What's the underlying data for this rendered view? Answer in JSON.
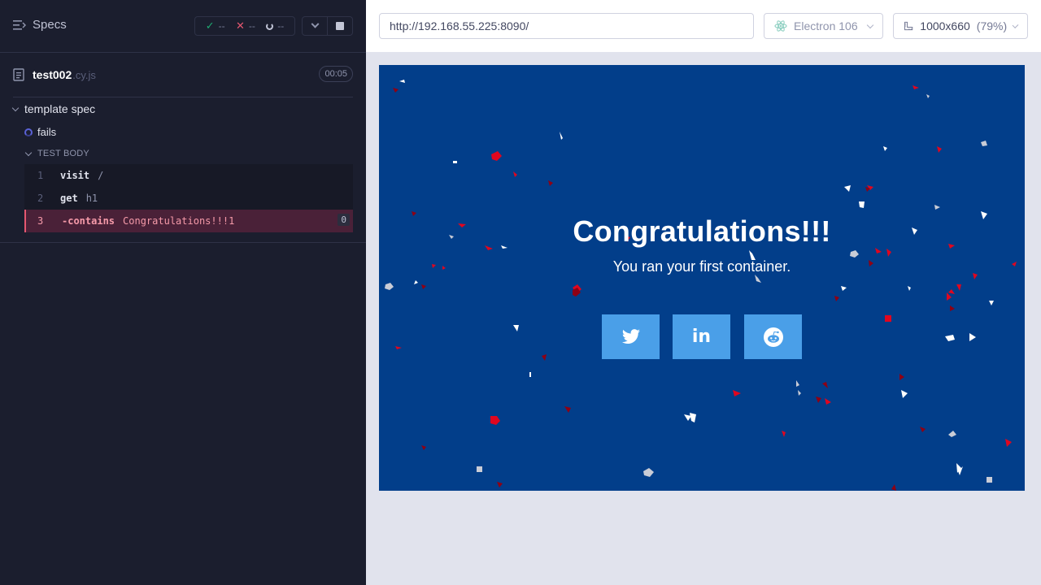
{
  "reporter": {
    "specs_label": "Specs",
    "stats": {
      "passed": "--",
      "failed": "--",
      "pending": "--"
    },
    "file": {
      "name": "test002",
      "ext": ".cy.js",
      "duration": "00:05"
    },
    "suite_title": "template spec",
    "test_title": "fails",
    "body_label": "TEST BODY",
    "commands": [
      {
        "num": "1",
        "name": "visit",
        "arg": "/"
      },
      {
        "num": "2",
        "name": "get",
        "arg": "h1"
      },
      {
        "num": "3",
        "name": "-contains",
        "arg": "Congratulations!!!1",
        "count": "0"
      }
    ]
  },
  "aut": {
    "url": "http://192.168.55.225:8090/",
    "browser": "Electron 106",
    "viewport": "1000x660",
    "scale": "(79%)"
  },
  "app": {
    "title": "Congratulations!!!",
    "subtitle": "You ran your first container.",
    "social": [
      "twitter-icon",
      "linkedin-icon",
      "reddit-icon"
    ],
    "colors": {
      "background": "#023e8a",
      "button": "#4a9fe8",
      "fail": "#e45770",
      "pass": "#1fa971"
    }
  }
}
